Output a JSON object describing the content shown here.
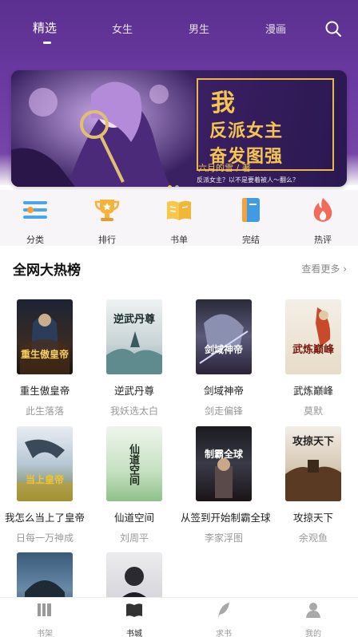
{
  "tabs": [
    {
      "label": "精选",
      "active": true
    },
    {
      "label": "女生"
    },
    {
      "label": "男生"
    },
    {
      "label": "漫画"
    }
  ],
  "banner": {
    "line1": "我",
    "line2": "反派女主",
    "line3": "奋发图强",
    "author": "六月的雪 / 著",
    "tagline": "反派女主？以不是要着被人～翻么？"
  },
  "categories": [
    {
      "label": "分类",
      "icon": "list-icon"
    },
    {
      "label": "排行",
      "icon": "trophy-icon"
    },
    {
      "label": "书单",
      "icon": "open-book-icon"
    },
    {
      "label": "完结",
      "icon": "bookmark-icon"
    },
    {
      "label": "热评",
      "icon": "flame-icon"
    }
  ],
  "hot_section": {
    "title": "全网大热榜",
    "more": "查看更多 ›"
  },
  "books": [
    {
      "name": "重生傲皇帝",
      "author": "此生落落",
      "cover_text": "重生傲皇帝"
    },
    {
      "name": "逆武丹尊",
      "author": "我妖选太白",
      "cover_text": "逆武丹尊"
    },
    {
      "name": "剑域神帝",
      "author": "剑走偏锋",
      "cover_text": "剑域神帝"
    },
    {
      "name": "武炼巅峰",
      "author": "莫默",
      "cover_text": "武炼巅峰"
    },
    {
      "name": "我怎么当上了皇帝",
      "author": "日每一万神成",
      "cover_text": "当上皇帝"
    },
    {
      "name": "仙道空间",
      "author": "刘周平",
      "cover_text": "仙道空间"
    },
    {
      "name": "从签到开始制霸全球",
      "author": "李家浮图",
      "cover_text": "制霸全球"
    },
    {
      "name": "攻掠天下",
      "author": "余观鱼",
      "cover_text": "攻掠天下"
    }
  ],
  "bottom_nav": [
    {
      "label": "书架",
      "icon": "bookshelf-icon"
    },
    {
      "label": "书城",
      "icon": "book-icon",
      "active": true
    },
    {
      "label": "求书",
      "icon": "feather-icon"
    },
    {
      "label": "我的",
      "icon": "user-icon"
    }
  ]
}
